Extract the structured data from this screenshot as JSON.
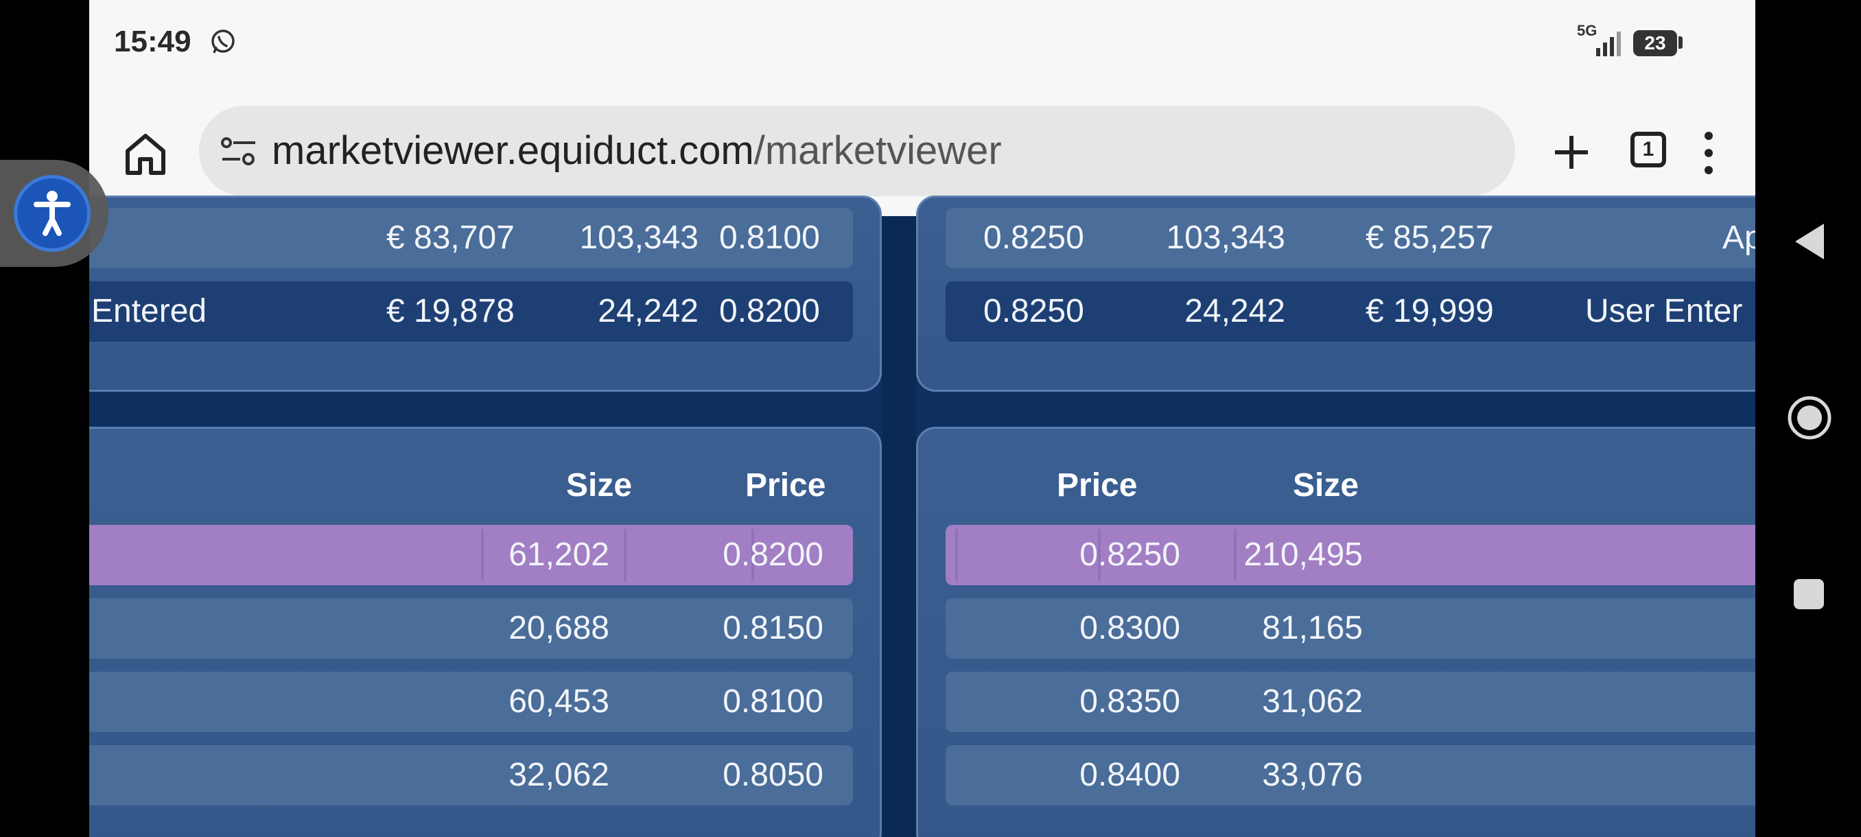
{
  "status_bar": {
    "time": "15:49",
    "network": "5G",
    "battery": "23",
    "icons": [
      "whatsapp-icon",
      "signal-icon",
      "battery-icon"
    ]
  },
  "browser": {
    "url_domain": "marketviewer.equiduct.com",
    "url_path": "/marketviewer",
    "tab_count": "1",
    "icons": [
      "home-icon",
      "site-settings-icon",
      "plus-icon",
      "tabs-icon",
      "more-vertical-icon"
    ]
  },
  "trades": {
    "left_rows": [
      {
        "label": "",
        "value": "€ 83,707",
        "size": "103,343",
        "price": "0.8100"
      },
      {
        "label": "Entered",
        "value": "€ 19,878",
        "size": "24,242",
        "price": "0.8200"
      }
    ],
    "right_rows": [
      {
        "price": "0.8250",
        "size": "103,343",
        "value": "€ 85,257",
        "label": "Ap"
      },
      {
        "price": "0.8250",
        "size": "24,242",
        "value": "€ 19,999",
        "label": "User Enter"
      }
    ]
  },
  "order_book": {
    "bid_headers": {
      "size": "Size",
      "price": "Price"
    },
    "ask_headers": {
      "price": "Price",
      "size": "Size"
    },
    "bids": [
      {
        "size": "61,202",
        "price": "0.8200"
      },
      {
        "size": "20,688",
        "price": "0.8150"
      },
      {
        "size": "60,453",
        "price": "0.8100"
      },
      {
        "size": "32,062",
        "price": "0.8050"
      }
    ],
    "asks": [
      {
        "price": "0.8250",
        "size": "210,495"
      },
      {
        "price": "0.8300",
        "size": "81,165"
      },
      {
        "price": "0.8350",
        "size": "31,062"
      },
      {
        "price": "0.8400",
        "size": "33,076"
      }
    ]
  },
  "colors": {
    "highlight_row": "#a27ec4",
    "panel": "#3b5f91",
    "background": "#0c2c5b",
    "accessibility": "#1c55b8"
  },
  "overlay_icons": [
    "accessibility-icon",
    "back-triangle-icon",
    "home-circle-icon",
    "recents-square-icon"
  ]
}
